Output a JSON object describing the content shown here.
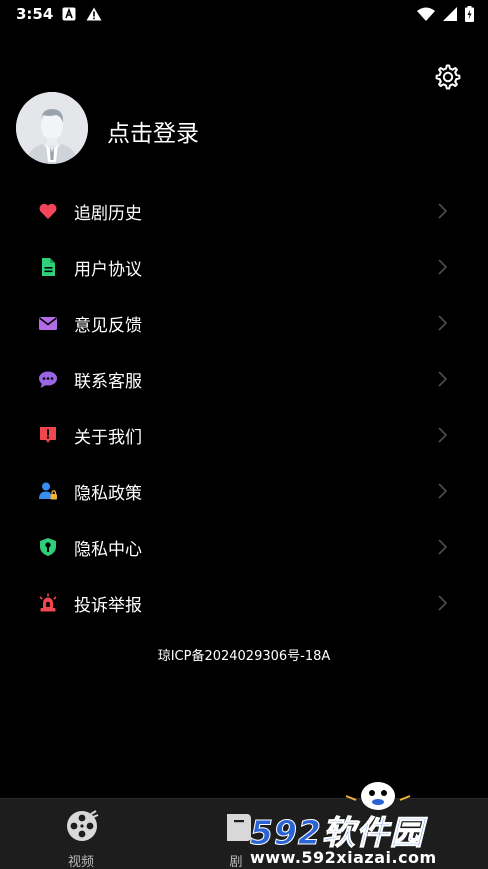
{
  "status_bar": {
    "time": "3:54"
  },
  "profile": {
    "login_label": "点击登录"
  },
  "menu": {
    "items": [
      {
        "label": "追剧历史",
        "icon": "heart-icon",
        "color": "#f2455a"
      },
      {
        "label": "用户协议",
        "icon": "document-icon",
        "color": "#2ed07a"
      },
      {
        "label": "意见反馈",
        "icon": "mail-icon",
        "color": "#b46be6"
      },
      {
        "label": "联系客服",
        "icon": "chat-bubble-icon",
        "color": "#9a66e6"
      },
      {
        "label": "关于我们",
        "icon": "alert-icon",
        "color": "#f0474f"
      },
      {
        "label": "隐私政策",
        "icon": "user-lock-icon",
        "color": "#3a8df0"
      },
      {
        "label": "隐私中心",
        "icon": "shield-key-icon",
        "color": "#2fcf7a"
      },
      {
        "label": "投诉举报",
        "icon": "alarm-light-icon",
        "color": "#f0474f"
      }
    ]
  },
  "icp": "琼ICP备2024029306号-18A",
  "tabbar": {
    "tabs": [
      {
        "label": "视频",
        "icon": "film-reel-icon"
      },
      {
        "label": "剧",
        "icon": "drama-icon"
      }
    ]
  },
  "watermark": {
    "brand": "592软件园",
    "url": "www.592xiazai.com"
  }
}
